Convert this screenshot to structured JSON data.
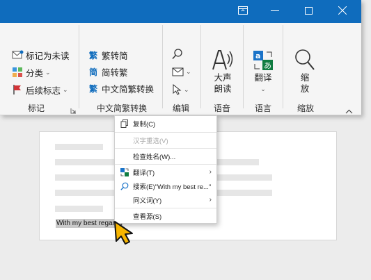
{
  "window_controls": {
    "restore_ribbon_icon": "ribbon-display-icon",
    "minimize_icon": "minimize-icon",
    "maximize_icon": "maximize-icon",
    "close_icon": "close-icon"
  },
  "ribbon": {
    "tags_group": {
      "label": "标记",
      "mark_unread": "标记为未读",
      "categorize": "分类",
      "follow_up": "后续标志"
    },
    "chinese_group": {
      "label": "中文简繁转换",
      "to_simplified": "繁转简",
      "to_traditional": "简转繁",
      "convert": "中文简繁转换"
    },
    "editing_group": {
      "label": "编辑"
    },
    "speech_group": {
      "label": "语音",
      "read_aloud_line1": "大声",
      "read_aloud_line2": "朗读"
    },
    "language_group": {
      "label": "语言",
      "translate": "翻译"
    },
    "zoom_group": {
      "label": "缩放",
      "zoom_line1": "缩",
      "zoom_line2": "放"
    }
  },
  "document": {
    "selected_text": "With my best regards"
  },
  "context_menu": {
    "items": [
      {
        "label": "复制(C)",
        "icon": "copy-icon",
        "disabled": false
      },
      {
        "label": "汉字重选(V)",
        "icon": "",
        "disabled": true
      },
      {
        "label": "检查姓名(W)...",
        "icon": "",
        "disabled": false
      },
      {
        "label": "翻译(T)",
        "icon": "translate-icon",
        "disabled": false,
        "submenu": true
      },
      {
        "label": "搜索(E)\"With my best re...\"",
        "icon": "search-icon",
        "disabled": false
      },
      {
        "label": "同义词(Y)",
        "icon": "",
        "disabled": false,
        "submenu": true
      },
      {
        "label": "查看源(S)",
        "icon": "",
        "disabled": false
      }
    ]
  },
  "colors": {
    "title_bar": "#0f6cbd",
    "cursor": "#f7b500",
    "flag_red": "#d13438"
  }
}
